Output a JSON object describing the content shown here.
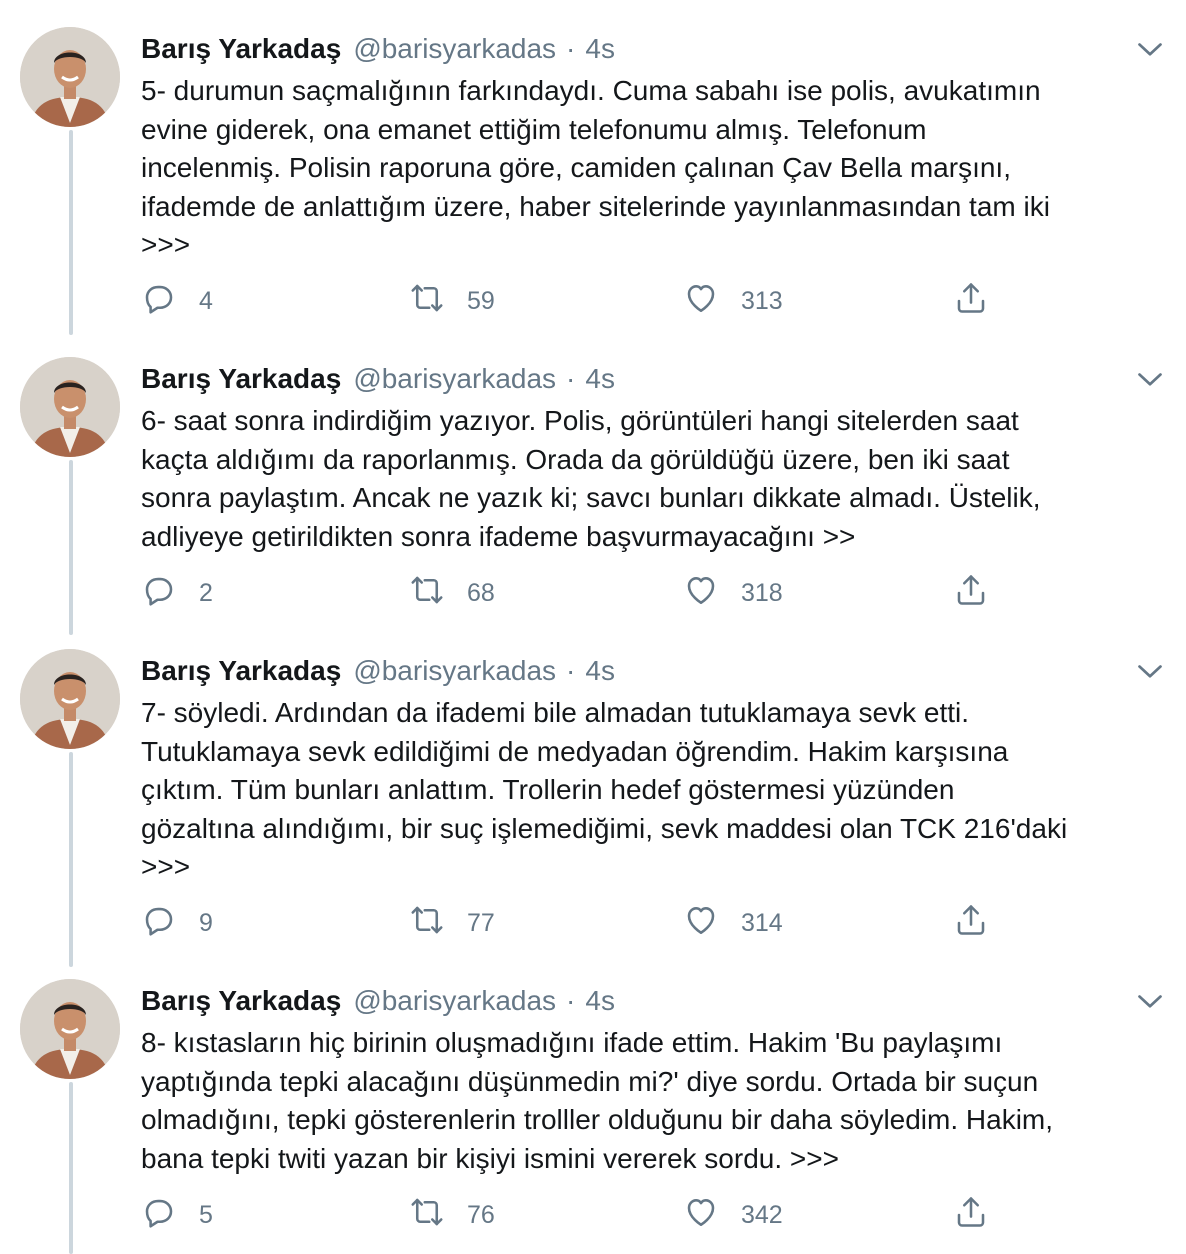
{
  "tweets": [
    {
      "author_name": "Barış Yarkadaş",
      "author_handle": "@barisyarkadas",
      "separator": "·",
      "time": "4s",
      "text": "5- durumun saçmalığının farkındaydı. Cuma sabahı ise polis, avukatımın\nevine giderek, ona emanet ettiğim telefonumu almış. Telefonum\nincelenmiş. Polisin raporuna göre, camiden çalınan Çav Bella marşını,\nifademde de anlattığım üzere, haber sitelerinde yayınlanmasından tam iki\n>>>",
      "replies": "4",
      "retweets": "59",
      "likes": "313"
    },
    {
      "author_name": "Barış Yarkadaş",
      "author_handle": "@barisyarkadas",
      "separator": "·",
      "time": "4s",
      "text": "6- saat sonra indirdiğim yazıyor. Polis, görüntüleri hangi sitelerden saat\nkaçta aldığımı da raporlanmış. Orada da görüldüğü üzere, ben iki saat\nsonra paylaştım. Ancak ne yazık ki; savcı bunları dikkate almadı. Üstelik,\nadliyeye getirildikten sonra ifademe başvurmayacağını >>",
      "replies": "2",
      "retweets": "68",
      "likes": "318"
    },
    {
      "author_name": "Barış Yarkadaş",
      "author_handle": "@barisyarkadas",
      "separator": "·",
      "time": "4s",
      "text": "7- söyledi. Ardından da ifademi bile almadan tutuklamaya sevk etti.\nTutuklamaya sevk edildiğimi de medyadan öğrendim. Hakim karşısına\nçıktım. Tüm bunları anlattım. Trollerin hedef göstermesi yüzünden\ngözaltına alındığımı, bir suç işlemediğimi, sevk maddesi olan TCK 216'daki\n>>>",
      "replies": "9",
      "retweets": "77",
      "likes": "314"
    },
    {
      "author_name": "Barış Yarkadaş",
      "author_handle": "@barisyarkadas",
      "separator": "·",
      "time": "4s",
      "text": "8- kıstasların hiç birinin oluşmadığını ifade ettim. Hakim 'Bu paylaşımı\nyaptığında tepki alacağını düşünmedin mi?' diye sordu. Ortada bir suçun\nolmadığını, tepki gösterenlerin trolller olduğunu bir daha söyledim. Hakim,\nbana tepki twiti yazan bir kişiyi ismini vererek sordu. >>>",
      "replies": "5",
      "retweets": "76",
      "likes": "342"
    }
  ],
  "icons": {
    "reply": "reply-icon",
    "retweet": "retweet-icon",
    "like": "heart-icon",
    "share": "share-icon",
    "menu": "chevron-down-icon",
    "avatar": "avatar"
  },
  "colors": {
    "text": "#14171a",
    "secondary": "#657786",
    "thread_line": "#ccd6dd",
    "background": "#ffffff"
  }
}
